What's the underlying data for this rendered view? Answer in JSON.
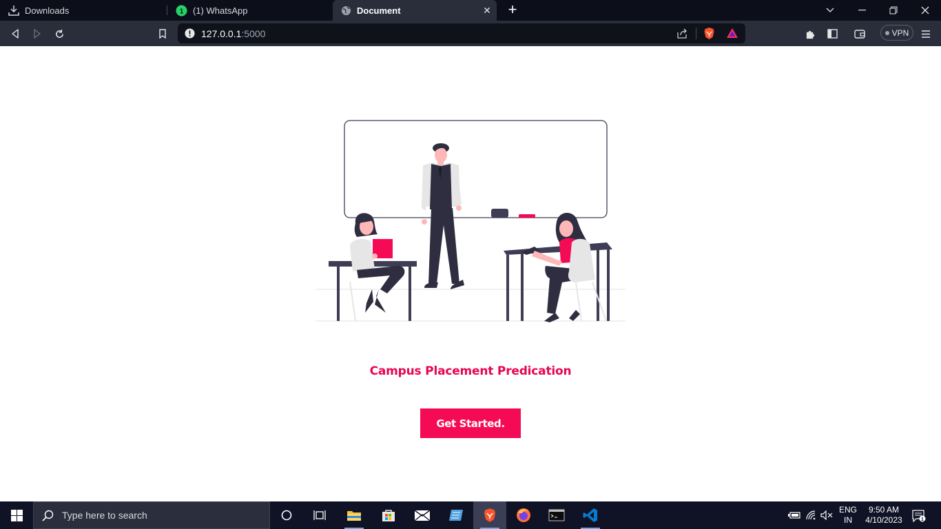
{
  "tabs": [
    {
      "label": "Downloads"
    },
    {
      "label": "(1) WhatsApp",
      "badge": "1"
    },
    {
      "label": "Document",
      "active": true
    }
  ],
  "address_bar": {
    "host": "127.0.0.1",
    "port": ":5000"
  },
  "vpn_label": "VPN",
  "page": {
    "heading": "Campus Placement Predication",
    "cta_label": "Get Started."
  },
  "taskbar": {
    "search_placeholder": "Type here to search",
    "language": "ENG",
    "region": "IN",
    "time": "9:50 AM",
    "date": "4/10/2023",
    "notification_count": "1"
  },
  "colors": {
    "accent": "#f50a55",
    "heading": "#e8054f",
    "illustration_dark": "#3f3d56",
    "browser_bg": "#2a2e3a",
    "taskbar_bg": "#101326"
  }
}
